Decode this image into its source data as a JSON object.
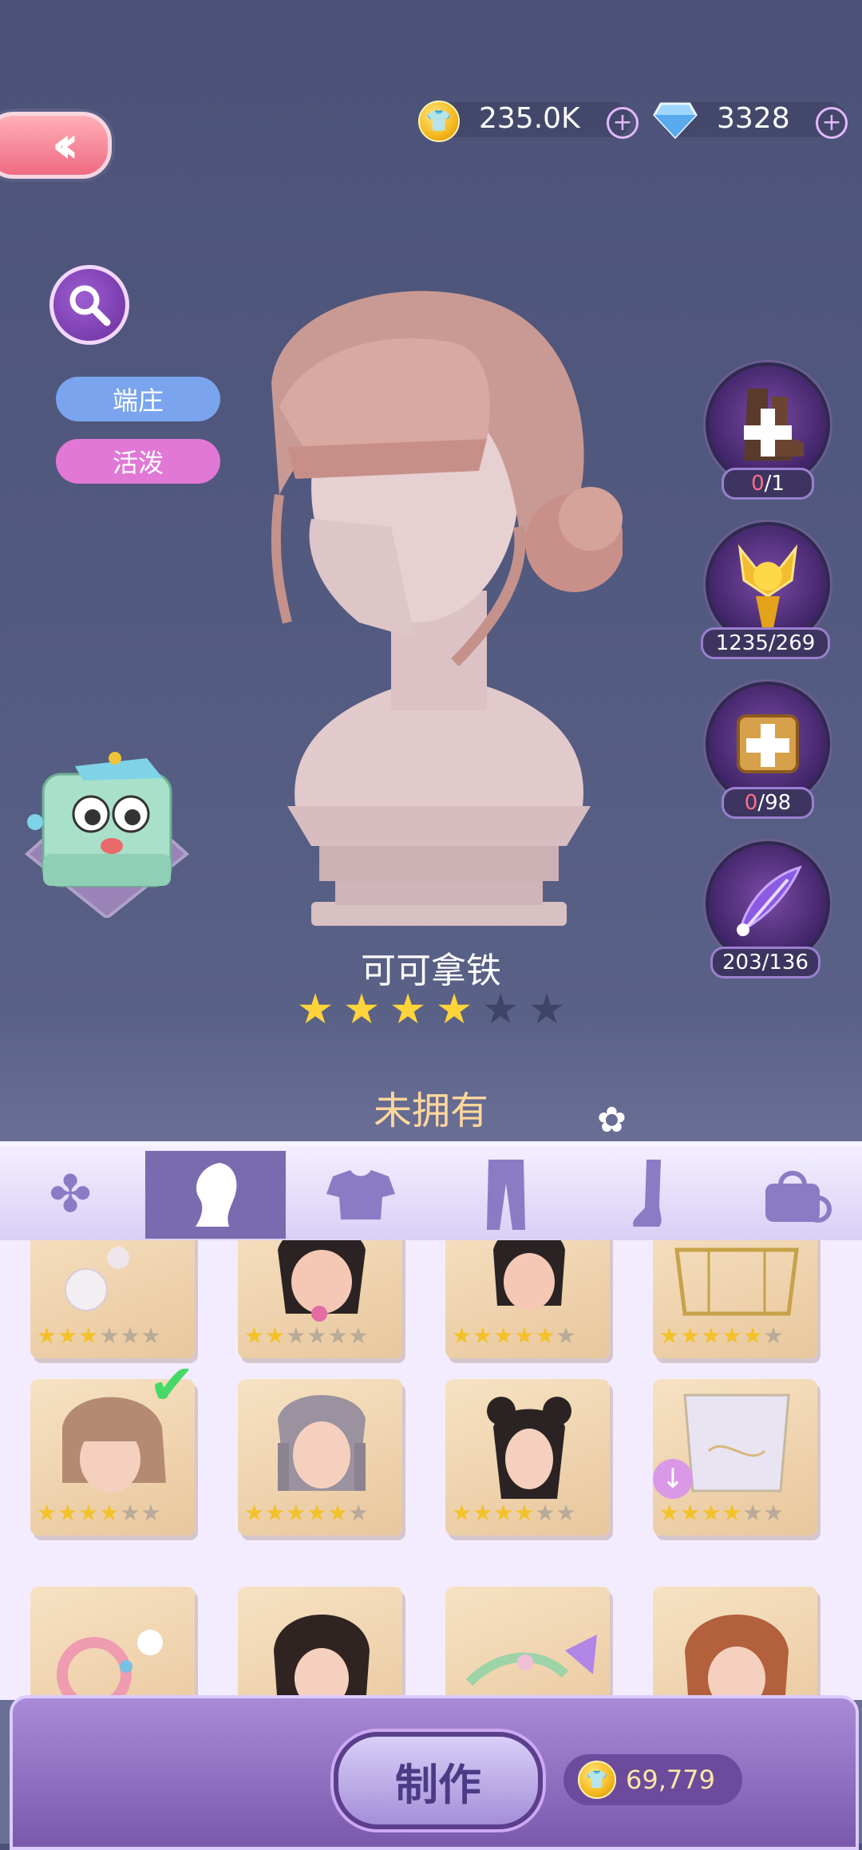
{
  "topbar": {
    "back_icon": "double-chevron-left",
    "gold_amount": "235.0K",
    "diamond_amount": "3328"
  },
  "left_panel": {
    "search_icon": "magnifier",
    "tags": [
      "端庄",
      "活泼"
    ],
    "tag_colors": [
      "#7aa5ee",
      "#e178d6"
    ]
  },
  "materials": [
    {
      "icon": "boots-plus",
      "owned": "0",
      "required": "/1",
      "owned_short": true
    },
    {
      "icon": "gold-fox-statue",
      "label": "1235/269"
    },
    {
      "icon": "biscuit-plus",
      "owned": "0",
      "required": "/98",
      "owned_short": true
    },
    {
      "icon": "purple-feather",
      "label": "203/136"
    }
  ],
  "item": {
    "name": "可可拿铁",
    "stars_filled": 4,
    "stars_total": 6,
    "status": "未拥有"
  },
  "categories": [
    {
      "icon": "clover",
      "active": false
    },
    {
      "icon": "hair-silhouette",
      "active": true
    },
    {
      "icon": "top",
      "active": false
    },
    {
      "icon": "pants",
      "active": false
    },
    {
      "icon": "sock",
      "active": false
    },
    {
      "icon": "bag",
      "active": false
    }
  ],
  "grid": {
    "rows": [
      [
        {
          "stars": 3,
          "thumb": "pearls"
        },
        {
          "stars": 2,
          "thumb": "black-hair"
        },
        {
          "stars": 5,
          "thumb": "black-hair-bun"
        },
        {
          "stars": 5,
          "thumb": "gold-ornament"
        }
      ],
      [
        {
          "stars": 4,
          "thumb": "brown-bob",
          "selected": true
        },
        {
          "stars": 5,
          "thumb": "grey-braids"
        },
        {
          "stars": 4,
          "thumb": "black-buns"
        },
        {
          "stars": 4,
          "thumb": "cloud-veil",
          "download": true
        }
      ],
      [
        {
          "stars": 0,
          "thumb": "flower-wreath"
        },
        {
          "stars": 0,
          "thumb": "dark-curls",
          "download": true
        },
        {
          "stars": 0,
          "thumb": "butterfly-wreath",
          "download": true
        },
        {
          "stars": 0,
          "thumb": "auburn-curls"
        }
      ]
    ],
    "stars_total": 6
  },
  "bottom": {
    "make_label": "制作",
    "cost": "69,779"
  }
}
